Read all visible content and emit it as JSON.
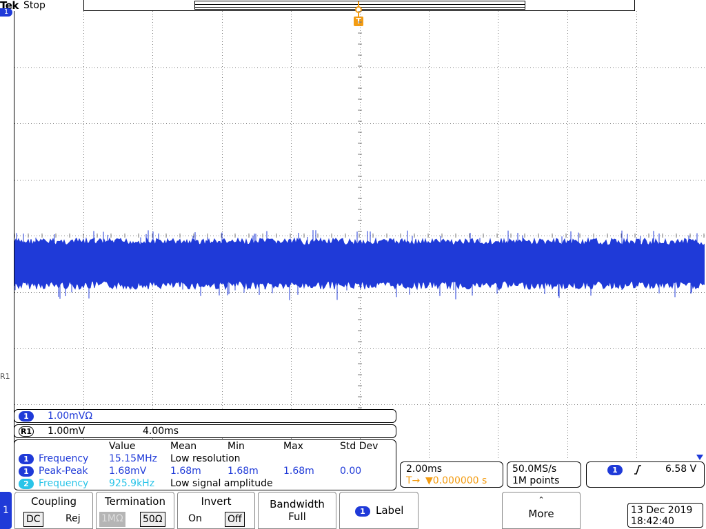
{
  "header": {
    "brand": "Tek",
    "status": "Stop"
  },
  "trigger_marker": "T",
  "channel_marker": "1",
  "ref_marker": "R1",
  "readouts": {
    "ch1": {
      "badge": "1",
      "scale": "1.00mVΩ"
    },
    "ref1": {
      "badge": "R1",
      "scale": "1.00mV",
      "time": "4.00ms"
    }
  },
  "measurements": {
    "headers": [
      "Value",
      "Mean",
      "Min",
      "Max",
      "Std Dev"
    ],
    "rows": [
      {
        "badge": "1",
        "name": "Frequency",
        "value": "15.15MHz",
        "note": "Low resolution",
        "mean": "",
        "min": "",
        "max": "",
        "std": "",
        "color": "#1f3ad8"
      },
      {
        "badge": "1",
        "name": "Peak-Peak",
        "value": "1.68mV",
        "note": "",
        "mean": "1.68m",
        "min": "1.68m",
        "max": "1.68m",
        "std": "0.00",
        "color": "#1f3ad8"
      },
      {
        "badge": "2",
        "name": "Frequency",
        "value": "925.9kHz",
        "note": "Low signal amplitude",
        "mean": "",
        "min": "",
        "max": "",
        "std": "",
        "color": "#29c4e8"
      }
    ]
  },
  "timebase": {
    "scale": "2.00ms",
    "trigger_delay": "▼0.000000 s",
    "trigger_glyph": "T→"
  },
  "acquisition": {
    "rate": "50.0MS/s",
    "record": "1M points"
  },
  "trigger": {
    "badge": "1",
    "slope_icon": "rising-edge",
    "level": "6.58 V"
  },
  "menu": {
    "channel_tab": "1",
    "coupling": {
      "title": "Coupling",
      "options": [
        "DC",
        "Rej"
      ],
      "selected": "DC"
    },
    "termination": {
      "title": "Termination",
      "options": [
        "1MΩ",
        "50Ω"
      ],
      "selected": "50Ω",
      "disabled": "1MΩ"
    },
    "invert": {
      "title": "Invert",
      "options": [
        "On",
        "Off"
      ],
      "selected": "Off"
    },
    "bandwidth": {
      "title": "Bandwidth",
      "value": "Full"
    },
    "label": {
      "badge": "1",
      "title": "Label"
    },
    "more": {
      "title": "More"
    }
  },
  "datetime": {
    "date": "13 Dec  2019",
    "time": "18:42:40"
  },
  "colors": {
    "ch1": "#1f3ad8",
    "ch2": "#29c4e8",
    "trigger": "#f39c12"
  }
}
